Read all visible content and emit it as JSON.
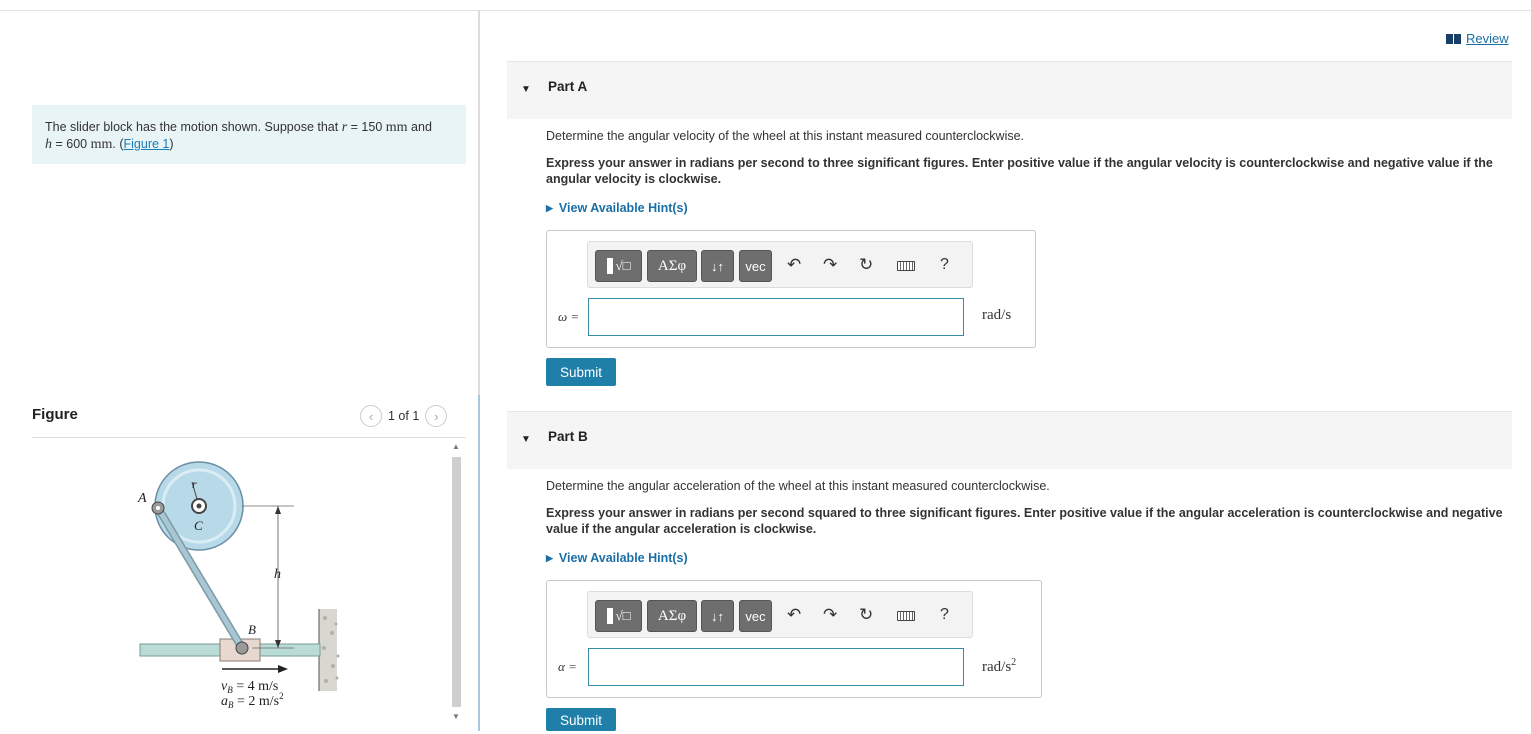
{
  "review": {
    "label": "Review"
  },
  "intro": {
    "text1": "The slider block has the motion shown. Suppose that",
    "r_var": "r",
    "eq1": "= 150",
    "r_unit": "mm",
    "and_text": "and",
    "h_var": "h",
    "eq2": "= 600",
    "h_unit": "mm",
    "figure_link": "Figure 1"
  },
  "figure": {
    "title": "Figure",
    "pager": "1 of 1",
    "labels": {
      "A": "A",
      "r": "r",
      "C": "C",
      "h": "h",
      "B": "B"
    },
    "vb": "v",
    "vb_sub": "B",
    "vb_val": " = 4 m/s",
    "ab": "a",
    "ab_sub": "B",
    "ab_val": " = 2 m/s",
    "ab_sup": "2"
  },
  "partA": {
    "title": "Part A",
    "question": "Determine the angular velocity of the wheel at this instant measured counterclockwise.",
    "instructions": "Express your answer in radians per second to three significant figures. Enter positive value if the angular velocity is counterclockwise and negative value if the angular velocity is clockwise.",
    "hint": "View Available Hint(s)",
    "var_label": "ω =",
    "value": "",
    "unit": "rad/s",
    "submit": "Submit"
  },
  "partB": {
    "title": "Part B",
    "question": "Determine the angular acceleration of the wheel at this instant measured counterclockwise.",
    "instructions": "Express your answer in radians per second squared to three significant figures. Enter positive value if the angular acceleration is counterclockwise and negative value if the angular acceleration is clockwise.",
    "hint": "View Available Hint(s)",
    "var_label": "α =",
    "value": "",
    "unit": "rad/s",
    "unit_sup": "2",
    "submit": "Submit"
  },
  "toolbar": {
    "symbols_label": "ΑΣφ",
    "arrows_label": "↓↑",
    "vec_label": "vec",
    "help_label": "?"
  }
}
